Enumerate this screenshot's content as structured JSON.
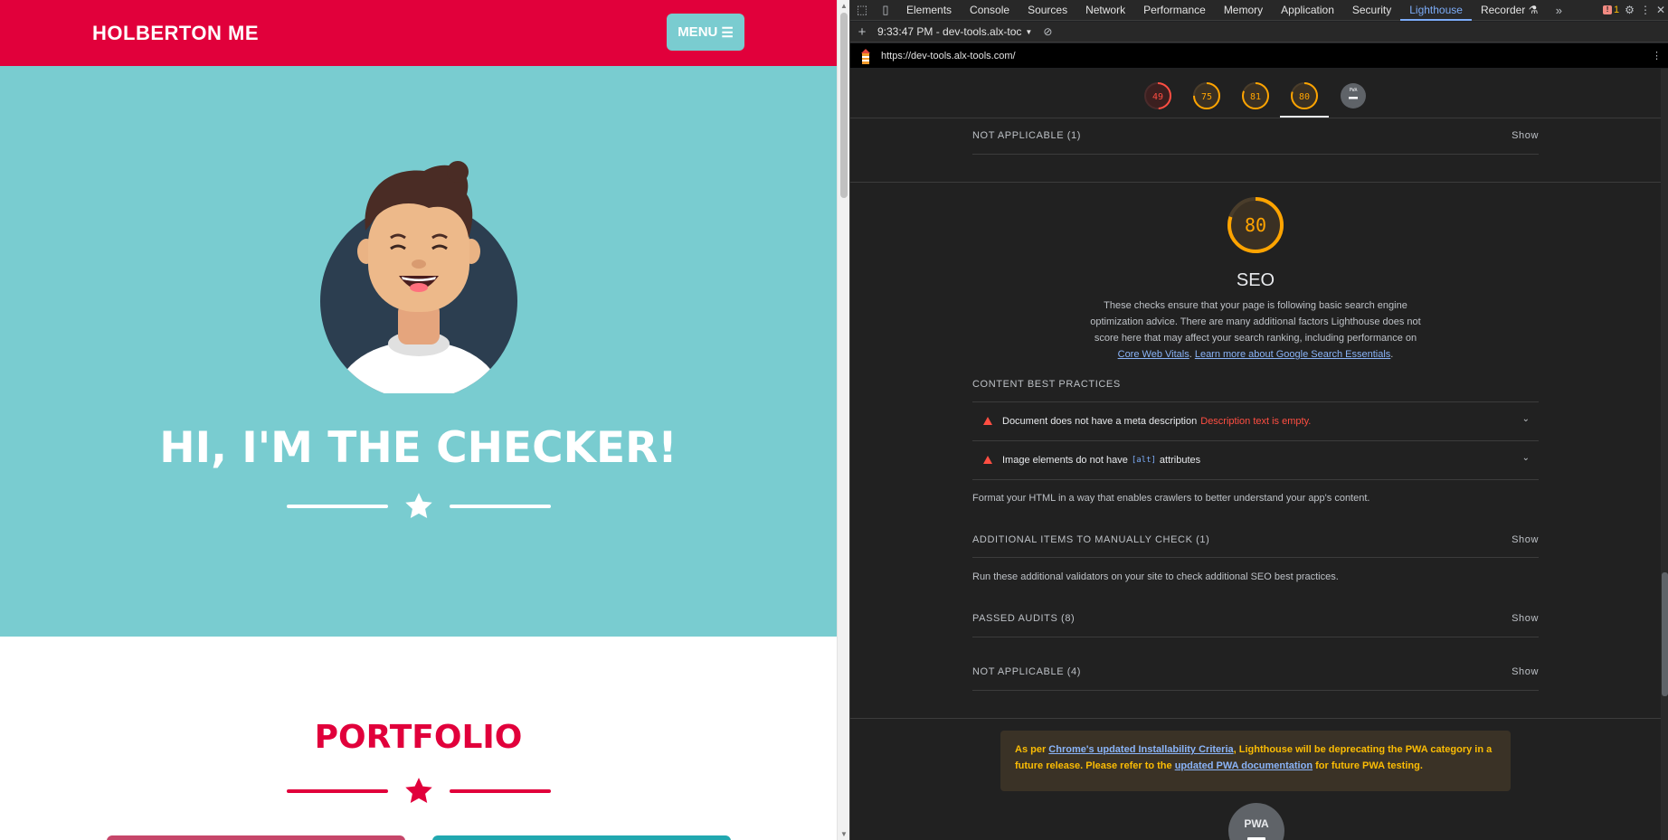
{
  "site": {
    "brand": "HOLBERTON ME",
    "menu_label": "MENU",
    "hero_title": "HI, I'M THE CHECKER!",
    "portfolio_title": "PORTFOLIO",
    "colors": {
      "primary": "#e1003b",
      "hero_bg": "#79ccd0",
      "menu_bg": "#7accd0"
    }
  },
  "devtools": {
    "tabs": [
      "Elements",
      "Console",
      "Sources",
      "Network",
      "Performance",
      "Memory",
      "Application",
      "Security",
      "Lighthouse",
      "Recorder"
    ],
    "active_tab": "Lighthouse",
    "issues_count": "1",
    "report_selector": "9:33:47 PM - dev-tools.alx-toc",
    "url": "https://dev-tools.alx-tools.com/",
    "mini_scores": [
      "49",
      "75",
      "81",
      "80"
    ],
    "mini_pwa_label": "PWA",
    "not_applicable_top": "NOT APPLICABLE (1)",
    "show_label": "Show",
    "seo": {
      "score": "80",
      "title": "SEO",
      "description": "These checks ensure that your page is following basic search engine optimization advice. There are many additional factors Lighthouse does not score here that may affect your search ranking, including performance on",
      "link_core_web_vitals": "Core Web Vitals",
      "link_search_essentials": "Learn more about Google Search Essentials"
    },
    "content_best_practices": "CONTENT BEST PRACTICES",
    "audits": [
      {
        "title": "Document does not have a meta description",
        "warning": "Description text is empty."
      },
      {
        "title_before": "Image elements do not have",
        "code": "[alt]",
        "title_after": "attributes"
      }
    ],
    "format_note": "Format your HTML in a way that enables crawlers to better understand your app's content.",
    "manual_check": "ADDITIONAL ITEMS TO MANUALLY CHECK (1)",
    "manual_note": "Run these additional validators on your site to check additional SEO best practices.",
    "passed_audits": "PASSED AUDITS (8)",
    "not_applicable_bottom": "NOT APPLICABLE (4)",
    "pwa_note": {
      "p1": "As per ",
      "link1": "Chrome's updated Installability Criteria",
      "p2": ", Lighthouse will be deprecating the PWA category in a future release. Please refer to the ",
      "link2": "updated PWA documentation",
      "p3": " for future PWA testing."
    },
    "pwa_badge": "PWA",
    "colors": {
      "score_average": "#ffa400",
      "score_fail": "#ff4e42",
      "link": "#8ab4f8",
      "tab_active": "#7cacf8"
    }
  }
}
